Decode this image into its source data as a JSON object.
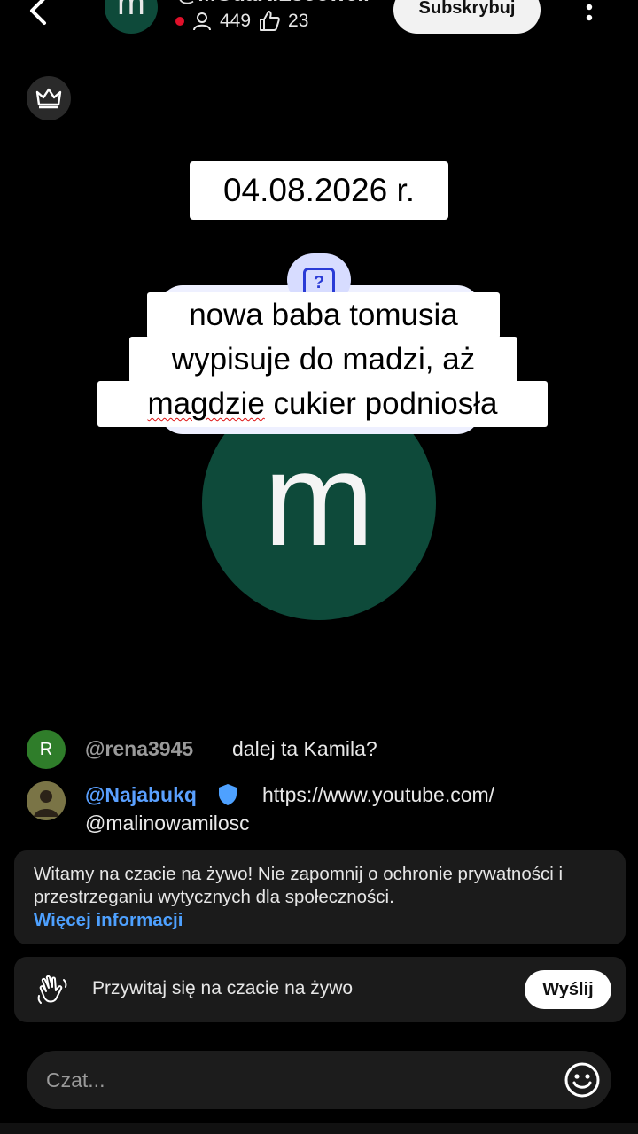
{
  "header": {
    "channel_name": "@MGdaRiLsoowell",
    "avatar_letter": "m",
    "viewers": "449",
    "likes": "23",
    "subscribe_label": "Subskrybuj",
    "back_icon": "chevron-left-icon",
    "more_icon": "more-vertical-icon",
    "live_color": "#e0102a"
  },
  "crown_icon": "crown-icon",
  "overlay": {
    "date": "04.08.2026 r.",
    "caption_line1": "nowa baba tomusia",
    "caption_line2": "wypisuje do madzi, aż",
    "caption_line3_underlined": "magdzie",
    "caption_line3_rest": " cukier podniosła",
    "question_badge": "?",
    "avatar_letter": "m",
    "avatar_color": "#0e4a3a"
  },
  "chat": {
    "messages": [
      {
        "avatar_letter": "R",
        "author": "@rena3945",
        "text": "dalej ta Kamila?"
      },
      {
        "author": "@Najabukq",
        "verified": true,
        "text_line1": "https://www.youtube.com/",
        "text_line2": "@malinowamilosc"
      }
    ],
    "welcome": {
      "text": "Witamy na czacie na żywo! Nie zapomnij o ochronie prywatności i przestrzeganiu wytycznych dla społeczności.",
      "link": "Więcej informacji"
    },
    "greet": {
      "text": "Przywitaj się na czacie na żywo",
      "send_label": "Wyślij",
      "icon": "waving-hand-icon"
    },
    "input": {
      "placeholder": "Czat...",
      "emoji_icon": "emoji-icon"
    }
  },
  "colors": {
    "link_blue": "#4ea1ff",
    "author_blue": "#5aa0ff"
  }
}
